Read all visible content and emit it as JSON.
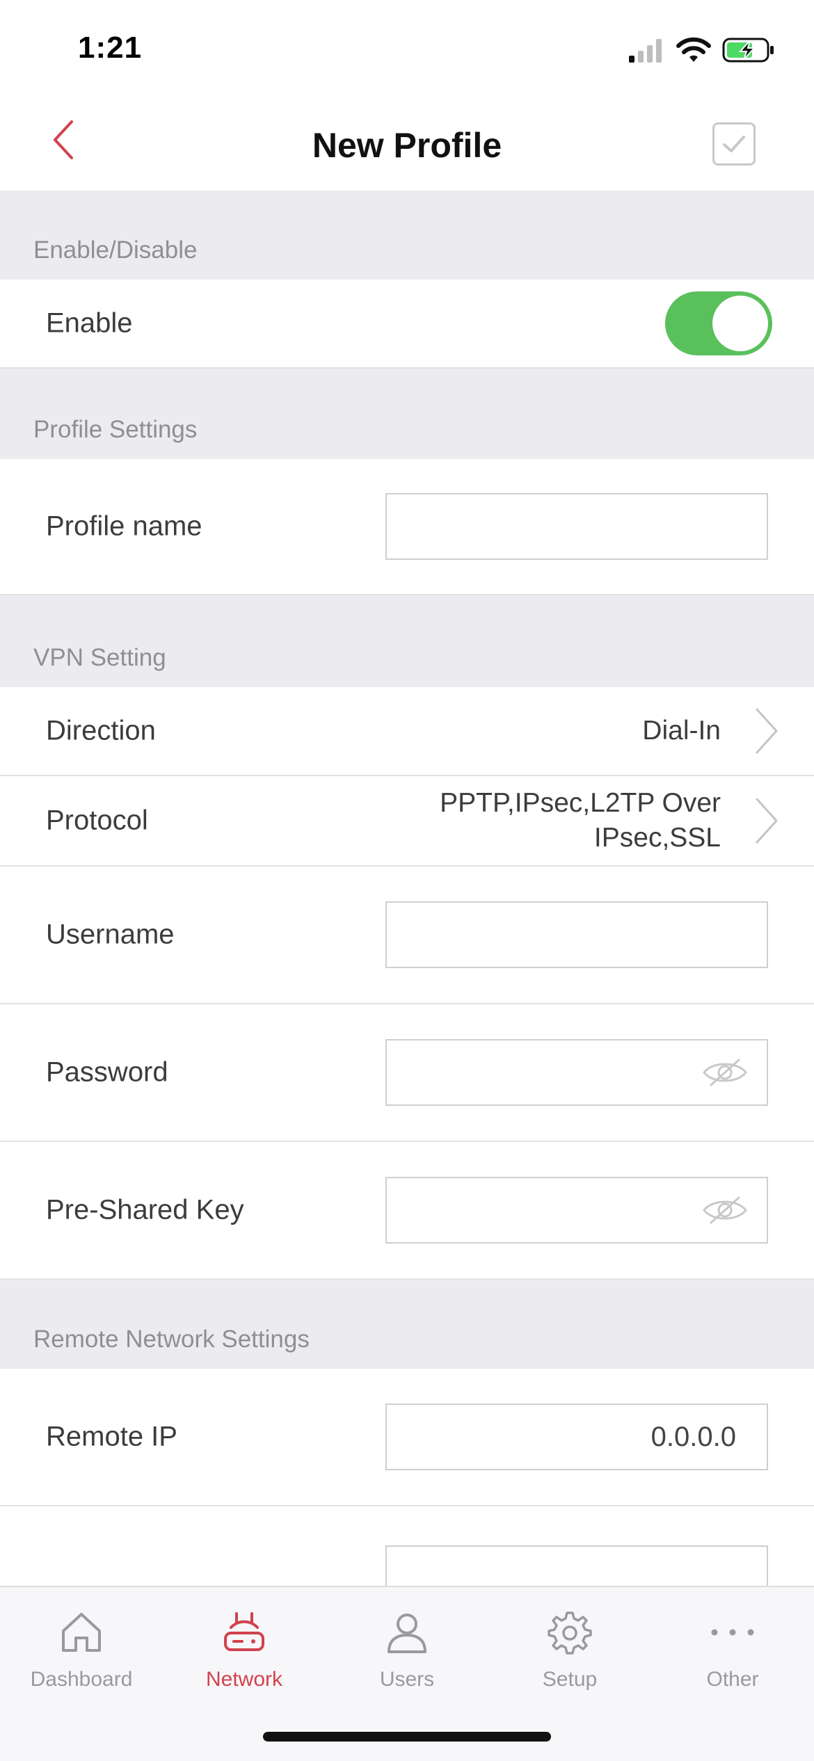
{
  "status_bar": {
    "time": "1:21"
  },
  "nav": {
    "title": "New Profile"
  },
  "sections": {
    "enable": {
      "header": "Enable/Disable",
      "enable_label": "Enable",
      "enabled": true
    },
    "profile": {
      "header": "Profile Settings",
      "profile_name_label": "Profile name",
      "profile_name_value": ""
    },
    "vpn": {
      "header": "VPN Setting",
      "direction_label": "Direction",
      "direction_value": "Dial-In",
      "protocol_label": "Protocol",
      "protocol_value_line1": "PPTP,IPsec,L2TP Over",
      "protocol_value_line2": "IPsec,SSL",
      "username_label": "Username",
      "username_value": "",
      "password_label": "Password",
      "password_value": "",
      "psk_label": "Pre-Shared Key",
      "psk_value": ""
    },
    "remote": {
      "header": "Remote Network Settings",
      "remote_ip_label": "Remote IP",
      "remote_ip_value": "0.0.0.0"
    }
  },
  "tabs": [
    {
      "label": "Dashboard",
      "icon": "home-icon",
      "active": false
    },
    {
      "label": "Network",
      "icon": "router-icon",
      "active": true
    },
    {
      "label": "Users",
      "icon": "user-icon",
      "active": false
    },
    {
      "label": "Setup",
      "icon": "gear-icon",
      "active": false
    },
    {
      "label": "Other",
      "icon": "more-icon",
      "active": false
    }
  ],
  "colors": {
    "accent": "#d1424f",
    "toggle_on": "#5ac05c",
    "section_bg": "#ececf0"
  }
}
